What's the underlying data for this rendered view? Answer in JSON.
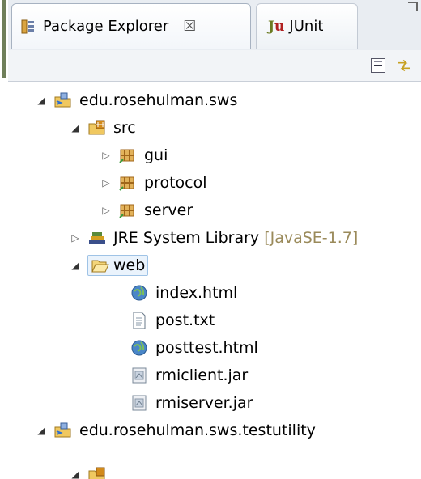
{
  "tabs": [
    {
      "label": "Package Explorer",
      "close": "☒",
      "active": true
    },
    {
      "label": "JUnit",
      "badge_j": "J",
      "badge_u": "u",
      "active": false
    }
  ],
  "tree": {
    "project1": {
      "label": "edu.rosehulman.sws",
      "expanded": true
    },
    "src": {
      "label": "src",
      "expanded": true
    },
    "pkg_gui": {
      "label": "gui"
    },
    "pkg_protocol": {
      "label": "protocol"
    },
    "pkg_server": {
      "label": "server"
    },
    "jre": {
      "label": "JRE System Library",
      "suffix": "[JavaSE-1.7]"
    },
    "web": {
      "label": "web",
      "expanded": true,
      "selected": true
    },
    "files": [
      {
        "label": "index.html",
        "icon": "html-file-icon"
      },
      {
        "label": "post.txt",
        "icon": "text-file-icon"
      },
      {
        "label": "posttest.html",
        "icon": "html-file-icon"
      },
      {
        "label": "rmiclient.jar",
        "icon": "jar-file-icon"
      },
      {
        "label": "rmiserver.jar",
        "icon": "jar-file-icon"
      }
    ],
    "project2": {
      "label": "edu.rosehulman.sws.testutility",
      "expanded": true
    }
  },
  "colors": {
    "jre_suffix": "#9a8a5a",
    "selection_border": "#9fc3e6",
    "package_icon": "#c98a1a"
  }
}
